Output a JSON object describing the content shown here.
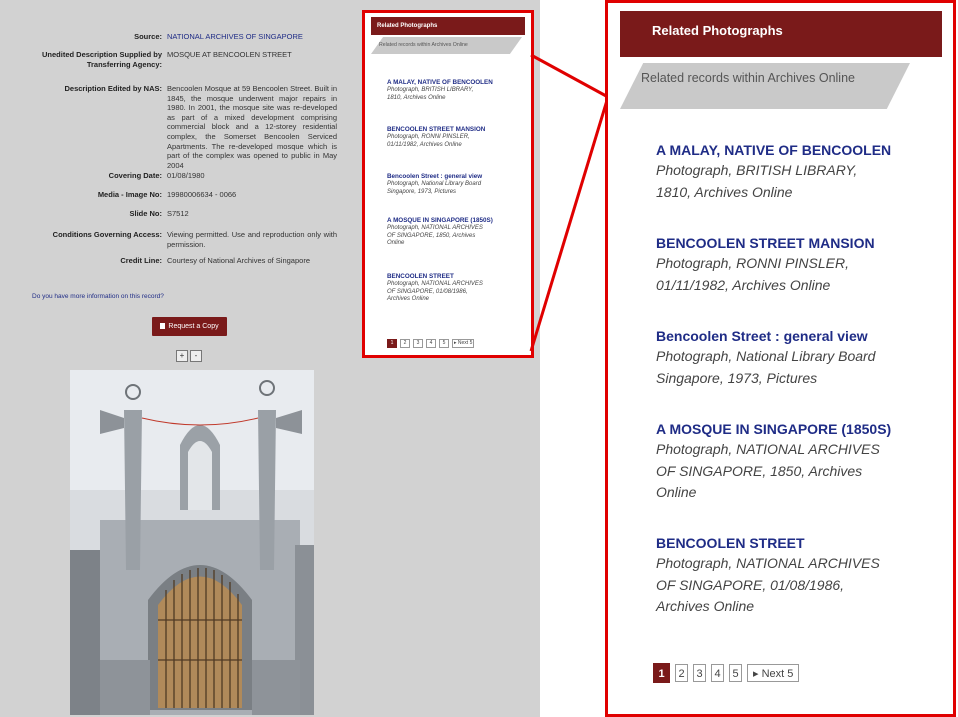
{
  "record": {
    "fields": [
      {
        "label": "Source:",
        "value": "NATIONAL ARCHIVES OF SINGAPORE"
      },
      {
        "label": "Unedited Description Supplied by Transferring Agency:",
        "value": "MOSQUE AT BENCOOLEN STREET"
      },
      {
        "label": "Description Edited by NAS:",
        "value": "Bencoolen Mosque at 59 Bencoolen Street. Built in 1845, the mosque underwent major repairs in 1980. In 2001, the mosque site was re-developed as part of a mixed development comprising commercial block and a 12-storey residential complex, the Somerset Bencoolen Serviced Apartments. The re-developed mosque which is part of the complex was opened to public in May 2004"
      },
      {
        "label": "Covering Date:",
        "value": "01/08/1980"
      },
      {
        "label": "Media - Image No:",
        "value": "19980006634 - 0066"
      },
      {
        "label": "Slide No:",
        "value": "S7512"
      },
      {
        "label": "Conditions Governing Access:",
        "value": "Viewing permitted. Use and reproduction only with permission."
      },
      {
        "label": "Credit Line:",
        "value": "Courtesy of National Archives of Singapore"
      }
    ],
    "more_info": "Do you have more information on this record?",
    "request_copy": "Request a Copy",
    "zoom_in": "+",
    "zoom_out": "-"
  },
  "related": {
    "header": "Related Photographs",
    "subheader": "Related records within Archives Online",
    "items": [
      {
        "title": "A MALAY, NATIVE OF BENCOOLEN",
        "desc_lines": [
          "Photograph, BRITISH LIBRARY,",
          "1810, Archives Online"
        ]
      },
      {
        "title": "BENCOOLEN STREET MANSION",
        "desc_lines": [
          "Photograph, RONNI PINSLER,",
          "01/11/1982, Archives Online"
        ]
      },
      {
        "title": "Bencoolen Street : general view",
        "desc_lines": [
          "Photograph, National Library Board",
          "Singapore, 1973, Pictures"
        ]
      },
      {
        "title": "A MOSQUE IN SINGAPORE (1850S)",
        "desc_lines": [
          "Photograph, NATIONAL ARCHIVES",
          "OF SINGAPORE, 1850, Archives",
          "Online"
        ]
      },
      {
        "title": "BENCOOLEN STREET",
        "desc_lines": [
          "Photograph, NATIONAL ARCHIVES",
          "OF SINGAPORE, 01/08/1986,",
          "Archives Online"
        ]
      }
    ],
    "pager": [
      "1",
      "2",
      "3",
      "4",
      "5"
    ],
    "next_label": "Next 5"
  },
  "colors": {
    "brand": "#7a1a1a",
    "highlight": "#e00000",
    "link": "#1f2c86"
  }
}
